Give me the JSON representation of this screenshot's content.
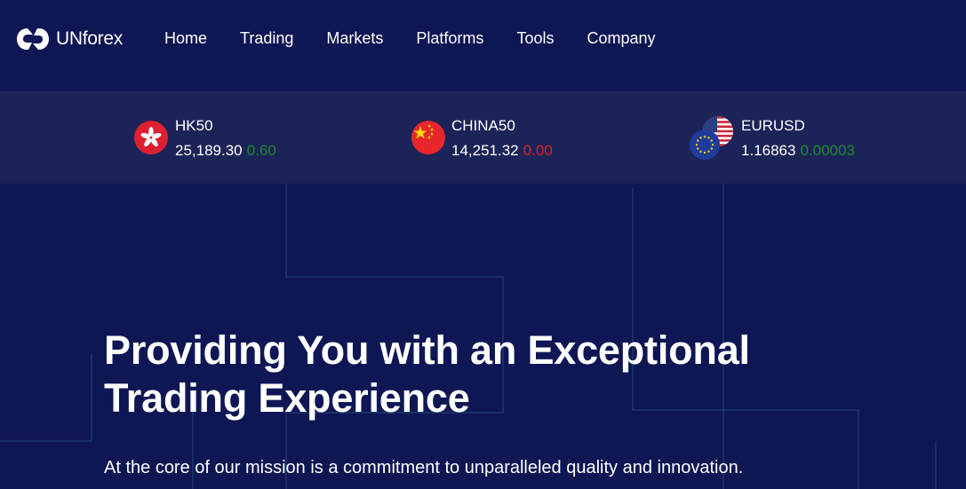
{
  "brand": {
    "name": "UNforex"
  },
  "nav": {
    "items": [
      {
        "label": "Home"
      },
      {
        "label": "Trading"
      },
      {
        "label": "Markets"
      },
      {
        "label": "Platforms"
      },
      {
        "label": "Tools"
      },
      {
        "label": "Company"
      }
    ]
  },
  "ticker": [
    {
      "symbol": "HK50",
      "price": "25,189.30",
      "change": "0.60",
      "direction": "up",
      "flag": "hong-kong-flag-icon"
    },
    {
      "symbol": "CHINA50",
      "price": "14,251.32",
      "change": "0.00",
      "direction": "down",
      "flag": "china-flag-icon"
    },
    {
      "symbol": "EURUSD",
      "price": "1.16863",
      "change": "0.00003",
      "direction": "up",
      "flag": "eu-us-flags-icon"
    }
  ],
  "hero": {
    "title": "Providing You with an Exceptional Trading Experience",
    "subtitle": "At the core of our mission is a commitment to unparalleled quality and innovation."
  },
  "colors": {
    "background": "#0f1654",
    "ticker_bg": "#1c2357",
    "up": "#1b8a2e",
    "down": "#e0202b"
  }
}
